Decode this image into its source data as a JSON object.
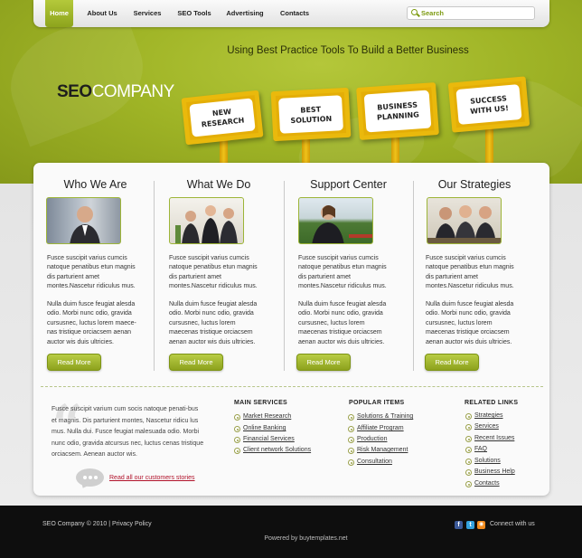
{
  "nav": {
    "items": [
      "Home",
      "About Us",
      "Services",
      "SEO Tools",
      "Advertising",
      "Contacts"
    ],
    "search_placeholder": "Search"
  },
  "header": {
    "tagline": "Using Best Practice Tools To Build a Better Business",
    "logo_part1": "SEO",
    "logo_part2": "COMPANY",
    "signs": [
      {
        "line1": "NEW RESEARCH",
        "line2": ""
      },
      {
        "line1": "BEST SOLUTION",
        "line2": ""
      },
      {
        "line1": "BUSINESS",
        "line2": "PLANNING"
      },
      {
        "line1": "SUCCESS",
        "line2": "WITH US!"
      }
    ]
  },
  "columns": [
    {
      "title": "Who We Are",
      "p1": "Fusce suscipit varius cumcis natoque penatibus etun magnis dis parturient  amet montes.Nascetur ridiculus mus.",
      "p2": "Nulla duim fusce feugiat alesda odio. Morbi nunc odio, gravida cursusnec, luctus lorem maece-nas tristique orciacsem aenan auctor wis duis ultricies.",
      "button": "Read More"
    },
    {
      "title": "What We Do",
      "p1": "Fusce suscipit varius cumcis natoque penatibus etun magnis dis parturient  amet montes.Nascetur ridiculus mus.",
      "p2": "Nulla duim fusce feugiat alesda odio. Morbi nunc odio, gravida cursusnec, luctus lorem maecenas tristique orciacsem aenan auctor wis duis ultricies.",
      "button": "Read More"
    },
    {
      "title": "Support Center",
      "p1": "Fusce suscipit varius cumcis natoque penatibus etun magnis dis parturient  amet montes.Nascetur ridiculus mus.",
      "p2": "Nulla duim fusce feugiat alesda odio. Morbi nunc odio, gravida cursusnec, luctus lorem maecenas tristique orciacsem aenan auctor wis duis ultricies.",
      "button": "Read More"
    },
    {
      "title": "Our Strategies",
      "p1": "Fusce suscipit varius cumcis natoque penatibus etun magnis dis parturient  amet montes.Nascetur ridiculus mus.",
      "p2": "Nulla duim fusce feugiat alesda odio. Morbi nunc odio, gravida cursusnec, luctus lorem maecenas tristique orciacsem aenan auctor wis duis ultricies.",
      "button": "Read More"
    }
  ],
  "testimonial": {
    "text": "Fusce suscipit varium cum socis natoque penati-bus et magnis. Dis parturient montes, Nascetur ridicu lus mus. Nulla dui. Fusce feugiat malesuada odio. Morbi nunc odio, gravida atcursus nec, luctus cenas tristique orciacsem. Aenean auctor wis.",
    "link": "Read all our customers stories"
  },
  "lists": {
    "main_services": {
      "heading": "MAIN SERVICES",
      "items": [
        "Market Research",
        "Online Banking",
        "Financial Services",
        "Client network Solutions"
      ]
    },
    "popular_items": {
      "heading": "POPULAR ITEMS",
      "items": [
        "Solutions & Training",
        "Affiliate Program",
        "Production",
        "Risk Management",
        "Consultation"
      ]
    },
    "related_links": {
      "heading": "RELATED LINKS",
      "items": [
        "Strategies",
        "Services",
        "Recent Issues",
        "FAQ",
        "Solutions",
        "Business Help",
        "Contacts"
      ]
    }
  },
  "footer": {
    "copyright": "SEO Company © 2010",
    "separator": "|",
    "privacy": "Privacy Policy",
    "connect": "Connect with us",
    "powered": "Powered by buytemplates.net",
    "social": [
      "f",
      "t",
      "rss"
    ]
  },
  "colors": {
    "accent": "#9fb426",
    "dark_footer": "#0e0e0e",
    "link_red": "#b1132b",
    "sign_yellow": "#eab90c"
  }
}
